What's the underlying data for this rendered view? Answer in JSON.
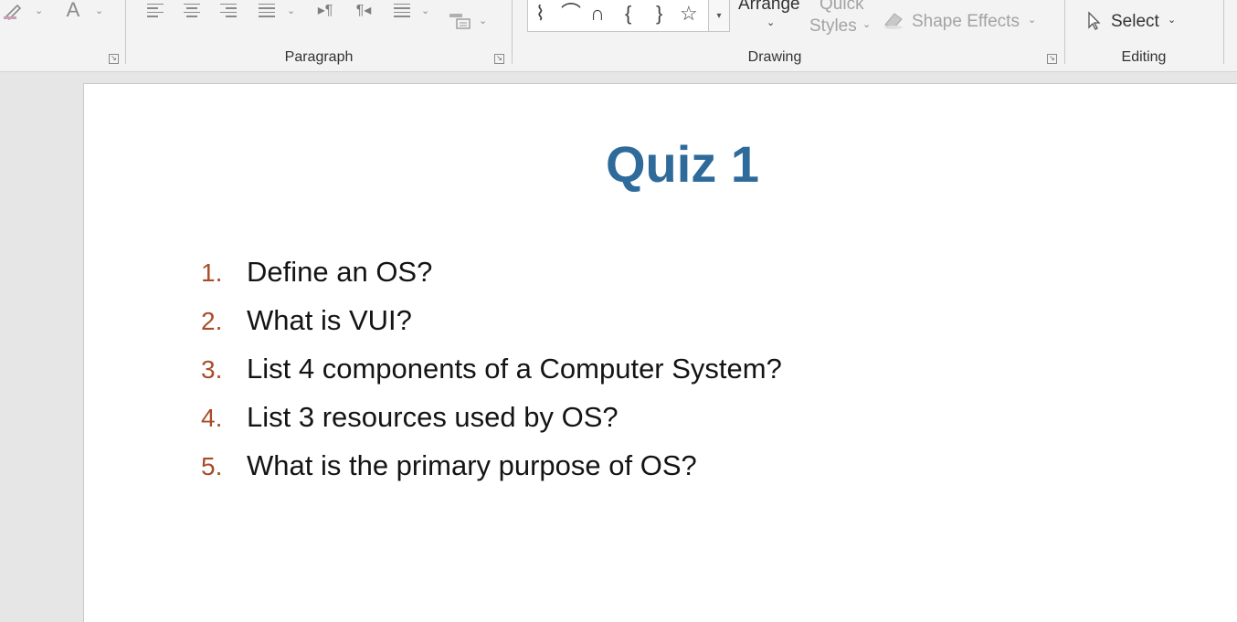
{
  "ribbon": {
    "paragraph_label": "Paragraph",
    "drawing_label": "Drawing",
    "editing_label": "Editing",
    "font_color_glyph": "A",
    "arrange_label": "Arrange",
    "quick_styles_line1": "Quick",
    "quick_styles_line2": "Styles",
    "shape_effects_label": "Shape Effects",
    "select_label": "Select",
    "shapes": [
      "⌇",
      "⌒",
      "∩",
      "{",
      "}",
      "☆"
    ]
  },
  "slide": {
    "title": "Quiz 1",
    "questions": [
      {
        "num": "1.",
        "text": "Define an OS?"
      },
      {
        "num": "2.",
        "text": "What is VUI?"
      },
      {
        "num": "3.",
        "text": "List 4 components of a Computer System?"
      },
      {
        "num": "4.",
        "text": "List 3 resources used by OS?"
      },
      {
        "num": "5.",
        "text": "What is the primary purpose of OS?"
      }
    ]
  },
  "colors": {
    "title": "#2e6a9a",
    "number": "#a84d2a",
    "ribbon_bg": "#f3f3f3",
    "workspace_bg": "#e6e6e6"
  },
  "icons": [
    "pen-icon",
    "font-color-icon",
    "align-left-icon",
    "align-center-icon",
    "align-right-icon",
    "justify-icon",
    "ltr-icon",
    "rtl-icon",
    "columns-icon",
    "smartart-icon",
    "shape-effects-icon",
    "cursor-icon"
  ]
}
